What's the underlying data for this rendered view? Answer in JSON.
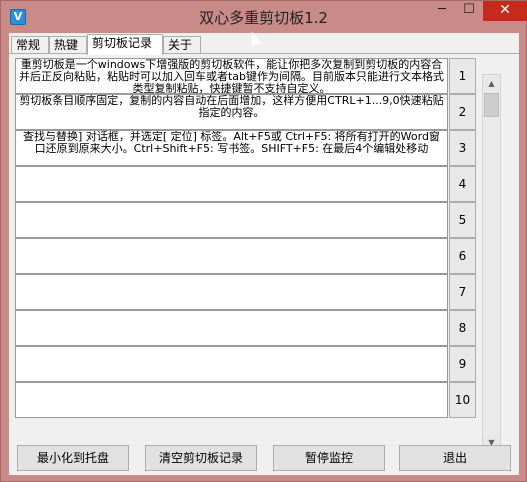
{
  "window": {
    "title": "双心多重剪切板1.2",
    "icon_glyph": "V",
    "minimize_glyph": "─",
    "maximize_glyph": "☐",
    "close_glyph": "✕"
  },
  "tabs": [
    {
      "label": "常规"
    },
    {
      "label": "热键"
    },
    {
      "label": "剪切板记录"
    },
    {
      "label": "关于"
    }
  ],
  "entries": [
    {
      "number": "1",
      "text": "重剪切板是一个windows下增强版的剪切板软件，能让你把多次复制到剪切板的内容合并后正反向粘贴，粘贴时可以加入回车或者tab键作为间隔。目前版本只能进行文本格式类型复制粘贴，快捷键暂不支持自定义。"
    },
    {
      "number": "2",
      "text": "剪切板条目顺序固定，复制的内容自动在后面增加，这样方便用CTRL+1...9,0快速粘贴指定的内容。"
    },
    {
      "number": "3",
      "text": "查找与替换] 对话框，并选定[ 定位] 标签。Alt+F5或 Ctrl+F5: 将所有打开的Word窗口还原到原来大小。Ctrl+Shift+F5: 写书签。SHIFT+F5: 在最后4个编辑处移动"
    },
    {
      "number": "4",
      "text": ""
    },
    {
      "number": "5",
      "text": ""
    },
    {
      "number": "6",
      "text": ""
    },
    {
      "number": "7",
      "text": ""
    },
    {
      "number": "8",
      "text": ""
    },
    {
      "number": "9",
      "text": ""
    },
    {
      "number": "10",
      "text": ""
    }
  ],
  "scrollbar": {
    "up_glyph": "▲",
    "down_glyph": "▼"
  },
  "buttons": {
    "minimize_to_tray": "最小化到托盘",
    "clear_records": "清空剪切板记录",
    "pause_monitor": "暂停监控",
    "exit": "退出"
  },
  "colors": {
    "titlebar": "#c98b88",
    "close_button": "#c42b1c",
    "panel": "#f0f0f0"
  }
}
